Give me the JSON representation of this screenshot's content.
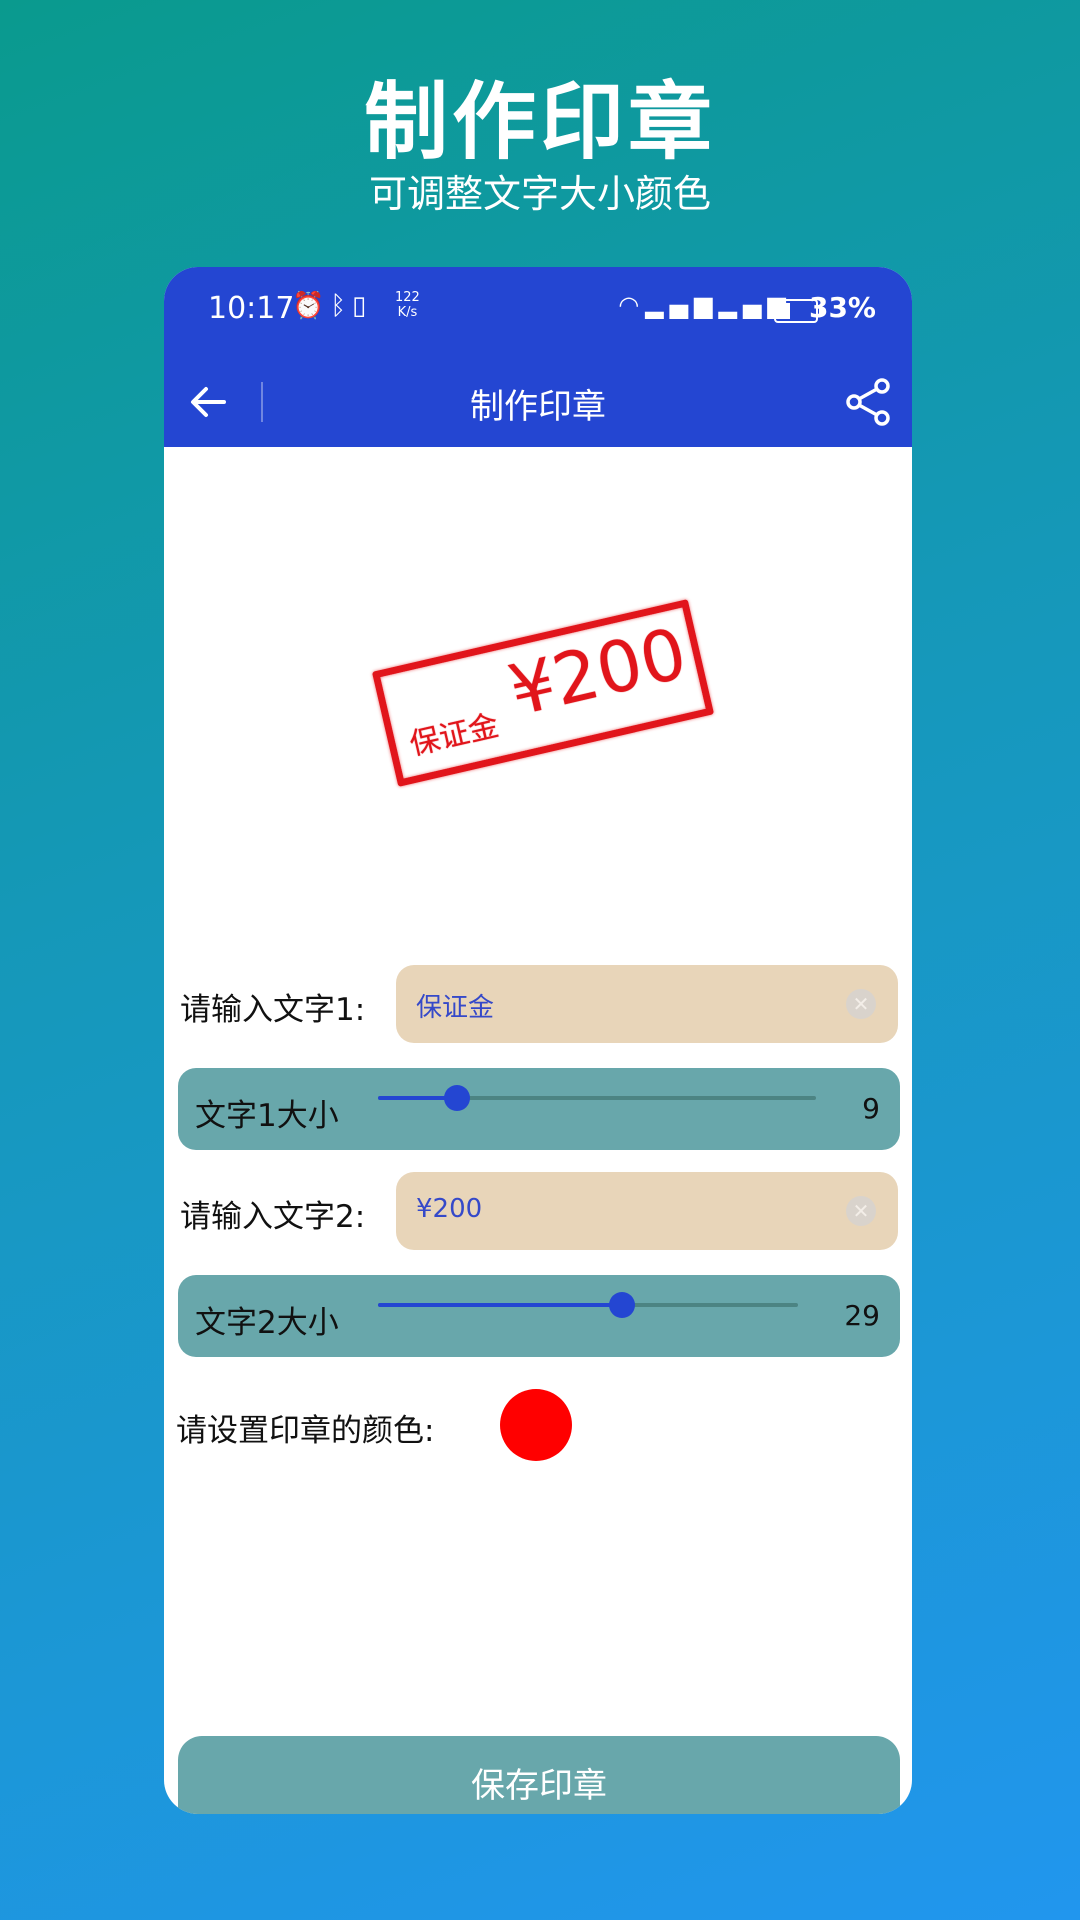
{
  "promo": {
    "title": "制作印章",
    "subtitle": "可调整文字大小颜色"
  },
  "status_bar": {
    "time": "10:17",
    "netspeed_value": "122",
    "netspeed_unit": "K/s",
    "battery_level": 0.33,
    "battery_text": "33%"
  },
  "app_bar": {
    "title": "制作印章",
    "back_icon": "arrow-left-icon",
    "share_icon": "share-icon"
  },
  "stamp_preview": {
    "text1": "保证金",
    "text2": "¥200",
    "color": "#e1151b"
  },
  "form": {
    "text1_label": "请输入文字1:",
    "text1_value": "保证金",
    "text1_size_label": "文字1大小",
    "text1_size_value": "9",
    "text1_size_fraction": 0.18,
    "text2_label": "请输入文字2:",
    "text2_value": "¥200",
    "text2_size_label": "文字2大小",
    "text2_size_value": "29",
    "text2_size_fraction": 0.58,
    "color_label": "请设置印章的颜色:",
    "color_value": "#ff0000"
  },
  "save_button": {
    "label": "保存印章"
  },
  "colors": {
    "primary": "#2446d2",
    "input_bg": "#e8d5b9",
    "slider_row_bg": "#68a7ab"
  }
}
